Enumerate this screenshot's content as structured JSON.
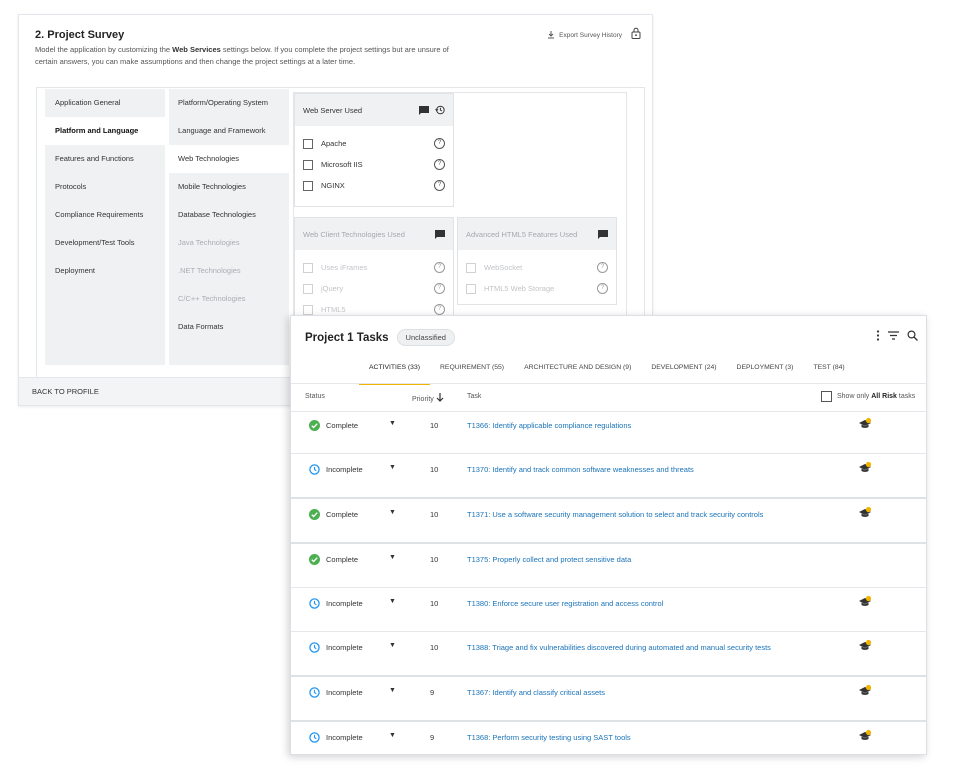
{
  "survey": {
    "title": "2. Project Survey",
    "description_pre": "Model the application by customizing the ",
    "description_bold": "Web Services",
    "description_post": " settings below. If you complete the project settings but are unsure of certain answers, you can make assumptions and then change the project settings at a later time.",
    "export_label": "Export Survey History",
    "categories": [
      {
        "label": "Application General",
        "active": false
      },
      {
        "label": "Platform and Language",
        "active": true
      },
      {
        "label": "Features and Functions",
        "active": false
      },
      {
        "label": "Protocols",
        "active": false
      },
      {
        "label": "Compliance Requirements",
        "active": false
      },
      {
        "label": "Development/Test Tools",
        "active": false
      },
      {
        "label": "Deployment",
        "active": false
      }
    ],
    "subcategories": [
      {
        "label": "Platform/Operating System",
        "state": "normal"
      },
      {
        "label": "Language and Framework",
        "state": "normal"
      },
      {
        "label": "Web Technologies",
        "state": "active"
      },
      {
        "label": "Mobile Technologies",
        "state": "normal"
      },
      {
        "label": "Database Technologies",
        "state": "normal"
      },
      {
        "label": "Java Technologies",
        "state": "disabled"
      },
      {
        "label": ".NET Technologies",
        "state": "disabled"
      },
      {
        "label": "C/C++ Technologies",
        "state": "disabled"
      },
      {
        "label": "Data Formats",
        "state": "normal"
      }
    ],
    "questions": {
      "web_server": {
        "title": "Web Server Used",
        "options": [
          "Apache",
          "Microsoft IIS",
          "NGINX"
        ]
      },
      "web_client": {
        "title": "Web Client Technologies Used",
        "options": [
          "Uses iFrames",
          "jQuery",
          "HTML5"
        ]
      },
      "html5": {
        "title": "Advanced HTML5 Features Used",
        "options": [
          "WebSocket",
          "HTML5 Web Storage"
        ]
      }
    },
    "back_label": "BACK TO PROFILE"
  },
  "tasks": {
    "title": "Project 1 Tasks",
    "badge": "Unclassified",
    "tabs": [
      {
        "label": "ACTIVITIES (33)",
        "active": true
      },
      {
        "label": "REQUIREMENT (55)",
        "active": false
      },
      {
        "label": "ARCHITECTURE AND DESIGN (9)",
        "active": false
      },
      {
        "label": "DEVELOPMENT (24)",
        "active": false
      },
      {
        "label": "DEPLOYMENT (3)",
        "active": false
      },
      {
        "label": "TEST (84)",
        "active": false
      }
    ],
    "columns": {
      "status": "Status",
      "priority": "Priority",
      "task": "Task",
      "show_only_pre": "Show only ",
      "show_only_bold": "All Risk",
      "show_only_post": " tasks"
    },
    "rows": [
      {
        "status": "Complete",
        "priority": "10",
        "task": "T1366: Identify applicable compliance regulations",
        "risk": true
      },
      {
        "status": "Incomplete",
        "priority": "10",
        "task": "T1370: Identify and track common software weaknesses and threats",
        "risk": true
      },
      {
        "status": "Complete",
        "priority": "10",
        "task": "T1371: Use a software security management solution to select and track security controls",
        "risk": true
      },
      {
        "status": "Complete",
        "priority": "10",
        "task": "T1375: Properly collect and protect sensitive data",
        "risk": false
      },
      {
        "status": "Incomplete",
        "priority": "10",
        "task": "T1380: Enforce secure user registration and access control",
        "risk": true
      },
      {
        "status": "Incomplete",
        "priority": "10",
        "task": "T1388: Triage and fix vulnerabilities discovered during automated and manual security tests",
        "risk": true
      },
      {
        "status": "Incomplete",
        "priority": "9",
        "task": "T1367: Identify and classify critical assets",
        "risk": true
      },
      {
        "status": "Incomplete",
        "priority": "9",
        "task": "T1368: Perform security testing using SAST tools",
        "risk": true
      }
    ]
  },
  "icons": {
    "complete": "check-circle-icon",
    "incomplete": "clock-icon",
    "risk": "risk-cap-icon",
    "more": "kebab-menu-icon",
    "filter": "filter-icon",
    "search": "search-icon"
  },
  "colors": {
    "complete": "#4caf50",
    "incomplete": "#2196f3",
    "accent": "#f0b400",
    "link": "#1a73b8"
  }
}
